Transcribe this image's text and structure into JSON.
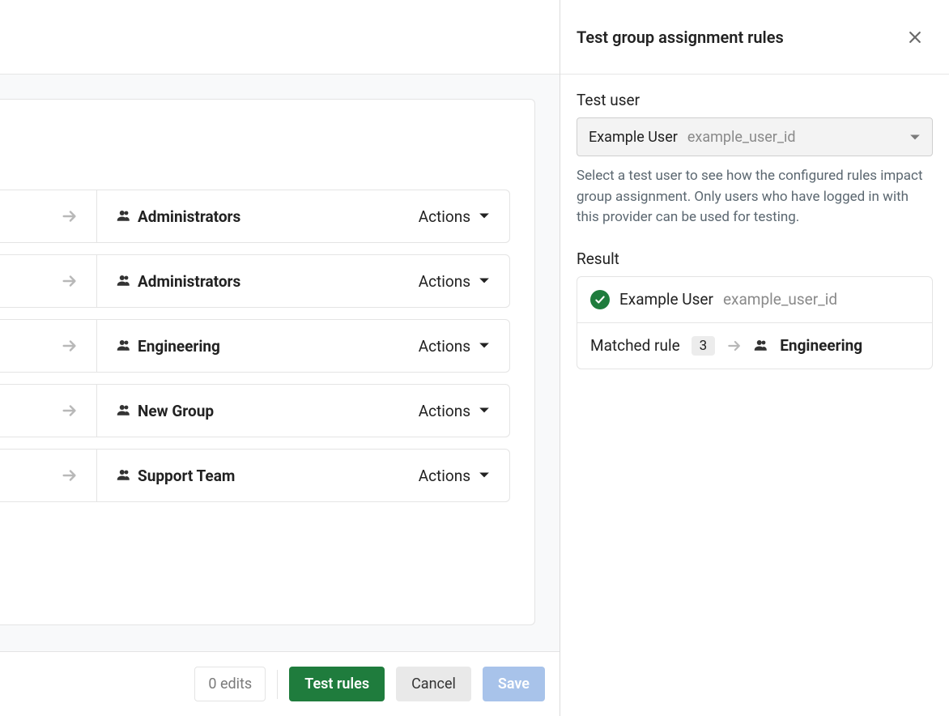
{
  "rules": [
    {
      "group": "Administrators",
      "actions_label": "Actions"
    },
    {
      "group": "Administrators",
      "actions_label": "Actions"
    },
    {
      "group": "Engineering",
      "actions_label": "Actions"
    },
    {
      "group": "New Group",
      "actions_label": "Actions"
    },
    {
      "group": "Support Team",
      "actions_label": "Actions"
    }
  ],
  "footer": {
    "edits": "0 edits",
    "test_rules": "Test rules",
    "cancel": "Cancel",
    "save": "Save"
  },
  "panel": {
    "title": "Test group assignment rules",
    "test_user_label": "Test user",
    "select": {
      "name": "Example User",
      "id": "example_user_id"
    },
    "help": "Select a test user to see how the configured rules impact group assignment. Only users who have logged in with this provider can be used for testing.",
    "result_label": "Result",
    "result": {
      "user_name": "Example User",
      "user_id": "example_user_id",
      "matched_label": "Matched rule",
      "matched_index": "3",
      "matched_group": "Engineering"
    }
  }
}
